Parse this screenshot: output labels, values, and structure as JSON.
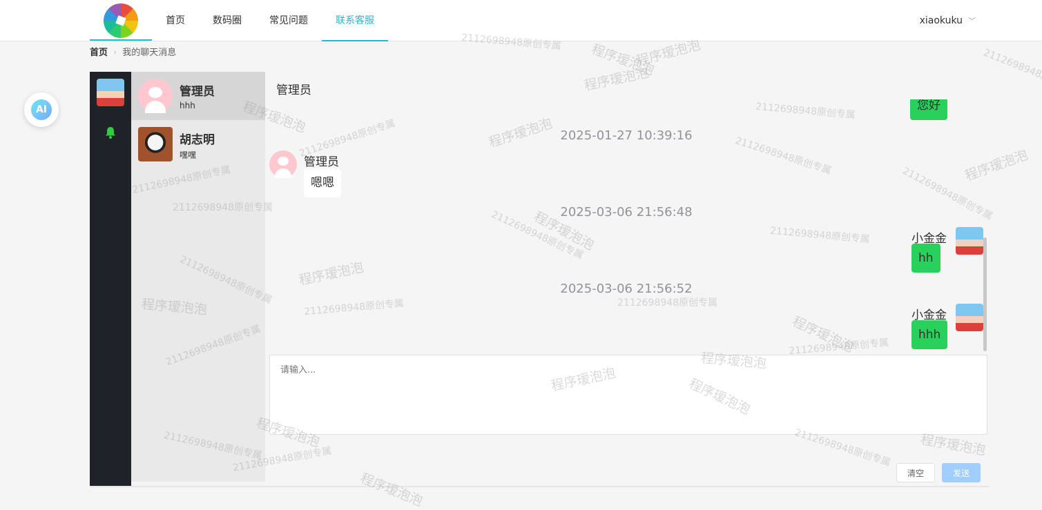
{
  "nav": {
    "items": [
      {
        "label": "首页",
        "active": false
      },
      {
        "label": "数码圈",
        "active": false
      },
      {
        "label": "常见问题",
        "active": false
      },
      {
        "label": "联系客服",
        "active": true
      }
    ],
    "user": "xiaokuku",
    "accent_color": "#29b6d6"
  },
  "breadcrumb": {
    "home": "首页",
    "current": "我的聊天消息"
  },
  "ai_button": {
    "label": "AI"
  },
  "contacts": [
    {
      "name": "管理员",
      "last_message": "hhh",
      "active": true
    },
    {
      "name": "胡志明",
      "last_message": "嘿嘿",
      "active": false
    }
  ],
  "chat": {
    "title": "管理员",
    "partial_top_bubble": "您好",
    "messages": [
      {
        "timestamp": "2025-01-27 10:39:16",
        "sender": "管理员",
        "text": "嗯嗯",
        "side": "left"
      },
      {
        "timestamp": "2025-03-06 21:56:48",
        "sender": "小金金",
        "text": "hh",
        "side": "right"
      },
      {
        "timestamp": "2025-03-06 21:56:52",
        "sender": "小金金",
        "text": "hhh",
        "side": "right"
      }
    ],
    "input_placeholder": "请输入...",
    "clear_label": "清空",
    "send_label": "发送"
  },
  "colors": {
    "sidebar_dark": "#1f2329",
    "bubble_green": "#29d05c",
    "send_disabled": "#a0cfff",
    "bell": "#2ecc40"
  },
  "watermarks": {
    "text_a": "2112698948原创专属",
    "text_b": "程序瑷泡泡"
  }
}
